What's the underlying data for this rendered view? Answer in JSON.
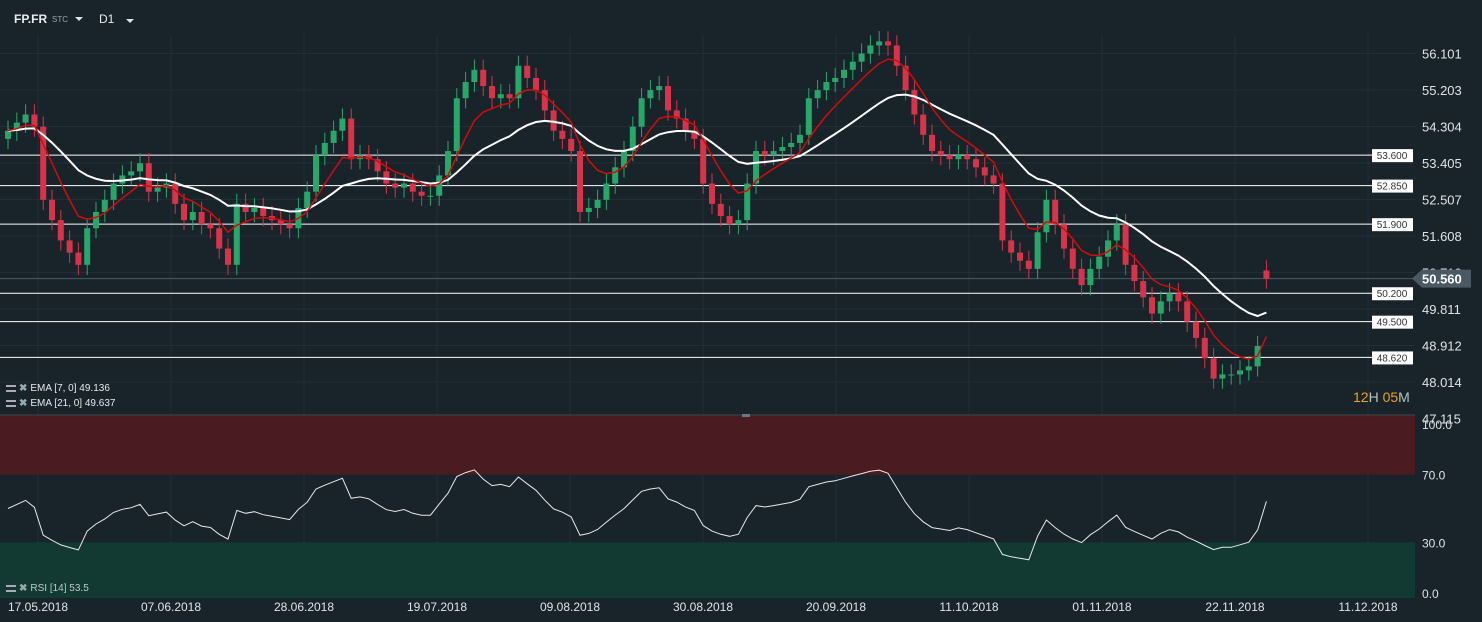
{
  "header": {
    "symbol": "FP.FR",
    "type": "STC",
    "timeframe": "D1"
  },
  "timer": {
    "hours": "12",
    "h": "H",
    "minutes": "05",
    "m": "M"
  },
  "indicators": {
    "ema7": {
      "label": "EMA [7, 0] 49.136",
      "color": "#d40b0b"
    },
    "ema21": {
      "label": "EMA [21, 0] 49.637",
      "color": "#ffffff"
    },
    "rsi": {
      "label": "RSI [14] 53.5"
    }
  },
  "colors": {
    "up": "#27a86a",
    "down": "#d8334a",
    "background": "#19232a",
    "rsi_overbought_zone": "#4a1c21",
    "rsi_oversold_zone": "#123a32"
  },
  "chart_data": {
    "type": "candlestick",
    "price_axis": {
      "ticks": [
        "56.101",
        "55.203",
        "54.304",
        "53.405",
        "52.507",
        "51.608",
        "50.710",
        "49.811",
        "48.912",
        "48.014",
        "47.115"
      ]
    },
    "current_price": "50.560",
    "horizontal_lines": [
      "53.600",
      "52.850",
      "51.900",
      "50.200",
      "49.500",
      "48.620"
    ],
    "date_labels": [
      "17.05.2018",
      "07.06.2018",
      "28.06.2018",
      "19.07.2018",
      "09.08.2018",
      "30.08.2018",
      "20.09.2018",
      "11.10.2018",
      "01.11.2018",
      "22.11.2018",
      "11.12.2018"
    ],
    "first_open": 54.0,
    "last_open": 50.76,
    "closes": [
      54.2,
      54.4,
      54.6,
      54.3,
      52.5,
      52.0,
      51.5,
      51.2,
      50.9,
      51.8,
      52.2,
      52.5,
      52.9,
      53.1,
      53.2,
      53.4,
      52.7,
      52.8,
      52.9,
      52.4,
      52.0,
      52.2,
      51.9,
      51.8,
      51.3,
      50.9,
      52.4,
      52.2,
      52.3,
      52.1,
      52.0,
      51.9,
      51.8,
      52.3,
      52.7,
      53.6,
      53.9,
      54.2,
      54.5,
      53.5,
      53.6,
      53.5,
      53.2,
      52.9,
      52.8,
      52.9,
      52.7,
      52.6,
      52.6,
      53.1,
      53.7,
      55.0,
      55.4,
      55.7,
      55.3,
      55.0,
      55.1,
      55.0,
      55.8,
      55.5,
      55.2,
      54.7,
      54.2,
      54.0,
      53.7,
      52.2,
      52.3,
      52.5,
      52.9,
      53.3,
      53.7,
      54.3,
      55.0,
      55.2,
      55.3,
      54.7,
      54.5,
      54.2,
      54.0,
      52.9,
      52.4,
      52.1,
      51.9,
      52.0,
      52.9,
      53.7,
      53.6,
      53.7,
      53.8,
      53.9,
      54.1,
      55.0,
      55.2,
      55.4,
      55.5,
      55.7,
      55.9,
      56.1,
      56.3,
      56.4,
      56.3,
      55.8,
      55.2,
      54.6,
      54.1,
      53.7,
      53.6,
      53.5,
      53.6,
      53.5,
      53.3,
      53.1,
      52.9,
      51.5,
      51.2,
      51.0,
      50.8,
      51.7,
      52.5,
      51.9,
      51.3,
      50.8,
      50.4,
      50.8,
      51.1,
      51.5,
      51.9,
      50.9,
      50.5,
      50.1,
      49.7,
      50.0,
      50.2,
      50.0,
      49.5,
      49.1,
      48.6,
      48.1,
      48.2,
      48.2,
      48.3,
      48.4,
      48.9,
      50.56
    ],
    "rsi_axis": {
      "ticks": [
        "100.0",
        "70.0",
        "30.0",
        "0.0"
      ],
      "overbought": 70,
      "oversold": 30
    }
  }
}
